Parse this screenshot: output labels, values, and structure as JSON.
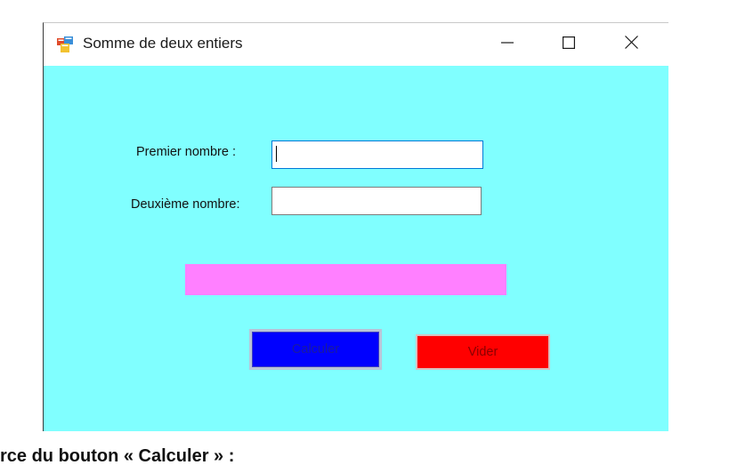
{
  "window": {
    "title": "Somme de deux entiers",
    "icon": "winforms-app-icon",
    "controls": {
      "minimize": "minimize-icon",
      "maximize": "maximize-icon",
      "close": "close-icon"
    }
  },
  "form": {
    "background_color": "#80ffff",
    "first_label": "Premier nombre :",
    "second_label": "Deuxième nombre:",
    "first_value": "",
    "second_value": "",
    "result_text": "",
    "result_color": "#ff80ff",
    "calculate_label": "Calculer",
    "calculate_color": "#0000ff",
    "clear_label": "Vider",
    "clear_color": "#ff0000"
  },
  "document": {
    "caption": "rce du bouton « Calculer » :"
  }
}
